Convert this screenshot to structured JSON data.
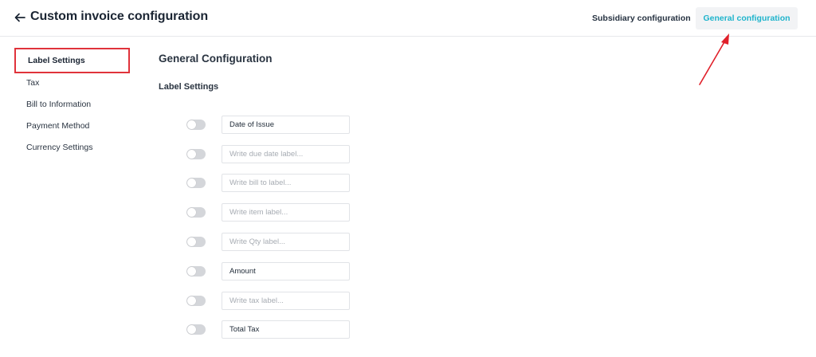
{
  "header": {
    "back_icon": "arrow-left-icon",
    "title": "Custom invoice configuration",
    "tabs": [
      {
        "label": "Subsidiary configuration",
        "active": false
      },
      {
        "label": "General configuration",
        "active": true
      }
    ]
  },
  "sidebar": {
    "items": [
      {
        "label": "Label Settings",
        "active": true
      },
      {
        "label": "Tax",
        "active": false
      },
      {
        "label": "Bill to Information",
        "active": false
      },
      {
        "label": "Payment Method",
        "active": false
      },
      {
        "label": "Currency Settings",
        "active": false
      }
    ]
  },
  "main": {
    "section_title": "General Configuration",
    "subsection_title": "Label Settings",
    "fields": [
      {
        "value": "Date of Issue",
        "placeholder": "",
        "enabled": false
      },
      {
        "value": "",
        "placeholder": "Write due date label...",
        "enabled": false
      },
      {
        "value": "",
        "placeholder": "Write bill to label...",
        "enabled": false
      },
      {
        "value": "",
        "placeholder": "Write item label...",
        "enabled": false
      },
      {
        "value": "",
        "placeholder": "Write Qty label...",
        "enabled": false
      },
      {
        "value": "Amount",
        "placeholder": "",
        "enabled": false
      },
      {
        "value": "",
        "placeholder": "Write tax label...",
        "enabled": false
      },
      {
        "value": "Total Tax",
        "placeholder": "",
        "enabled": false
      }
    ]
  },
  "colors": {
    "accent": "#1fb4cc",
    "highlight_box": "#e0333b",
    "annotation_arrow": "#e0202a",
    "toggle_off": "#d4d6da"
  }
}
